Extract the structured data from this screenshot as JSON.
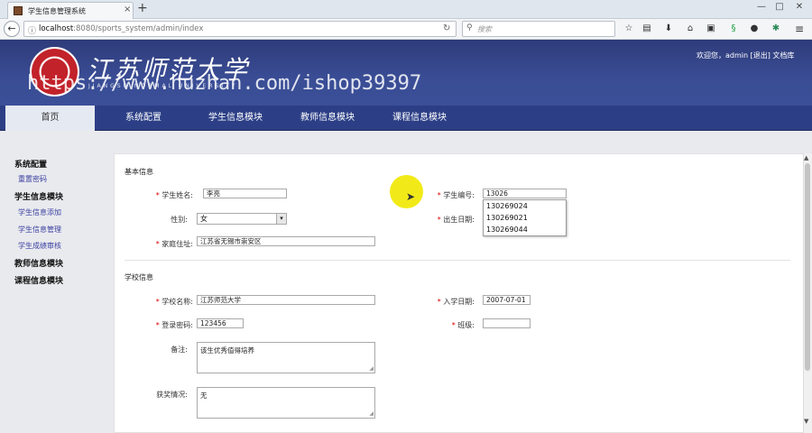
{
  "browser": {
    "tab_title": "学生信息管理系统",
    "tab_close": "×",
    "new_tab": "+",
    "window_controls": {
      "minimize": "—",
      "maximize": "□",
      "close": "✕"
    },
    "url_host": "localhost",
    "url_rest": ":8080/sports_system/admin/index",
    "search_placeholder": "搜索",
    "toolbar_icons": [
      "star-icon",
      "clipboard-icon",
      "download-icon",
      "home-icon",
      "image-icon",
      "extension-icon",
      "chat-icon",
      "puzzle-icon",
      "menu-icon"
    ]
  },
  "header": {
    "logo_text": "江苏师范大学",
    "logo_sub": "JIANGSU NORMAL UNIVERSITY",
    "watermark": "https://www.huzhan.com/ishop39397",
    "user_info": "欢迎您，admin [退出]  文档库"
  },
  "nav": {
    "items": [
      "首页",
      "系统配置",
      "学生信息模块",
      "教师信息模块",
      "课程信息模块"
    ],
    "active": "首页"
  },
  "sidebar": {
    "groups": [
      {
        "title": "系统配置",
        "links": [
          "重置密码"
        ]
      },
      {
        "title": "学生信息模块",
        "links": [
          "学生信息添加",
          "学生信息管理",
          "学生成绩审核"
        ]
      },
      {
        "title": "教师信息模块",
        "links": []
      },
      {
        "title": "课程信息模块",
        "links": []
      }
    ]
  },
  "form": {
    "basic_title": "基本信息",
    "school_title": "学校信息",
    "required_mark": "*",
    "fields": {
      "name": {
        "label": "学生姓名:",
        "value": "李亮"
      },
      "gender": {
        "label": "性别:",
        "value": "女"
      },
      "address": {
        "label": "家庭住址:",
        "value": "江苏省无锡市崇安区"
      },
      "student_no": {
        "label": "学生编号:",
        "value": "13026"
      },
      "birthday": {
        "label": "出生日期:"
      },
      "school": {
        "label": "学校名称:",
        "value": "江苏师范大学"
      },
      "password": {
        "label": "登录密码:",
        "value": "123456"
      },
      "remark": {
        "label": "备注:",
        "value": "该生优秀值得培养"
      },
      "award": {
        "label": "获奖情况:",
        "value": "无"
      },
      "enroll_date": {
        "label": "入学日期:",
        "value": "2007-07-01"
      },
      "class": {
        "label": "班级:",
        "value": ""
      }
    },
    "suggestions": [
      "130269024",
      "130269021",
      "130269044"
    ]
  }
}
